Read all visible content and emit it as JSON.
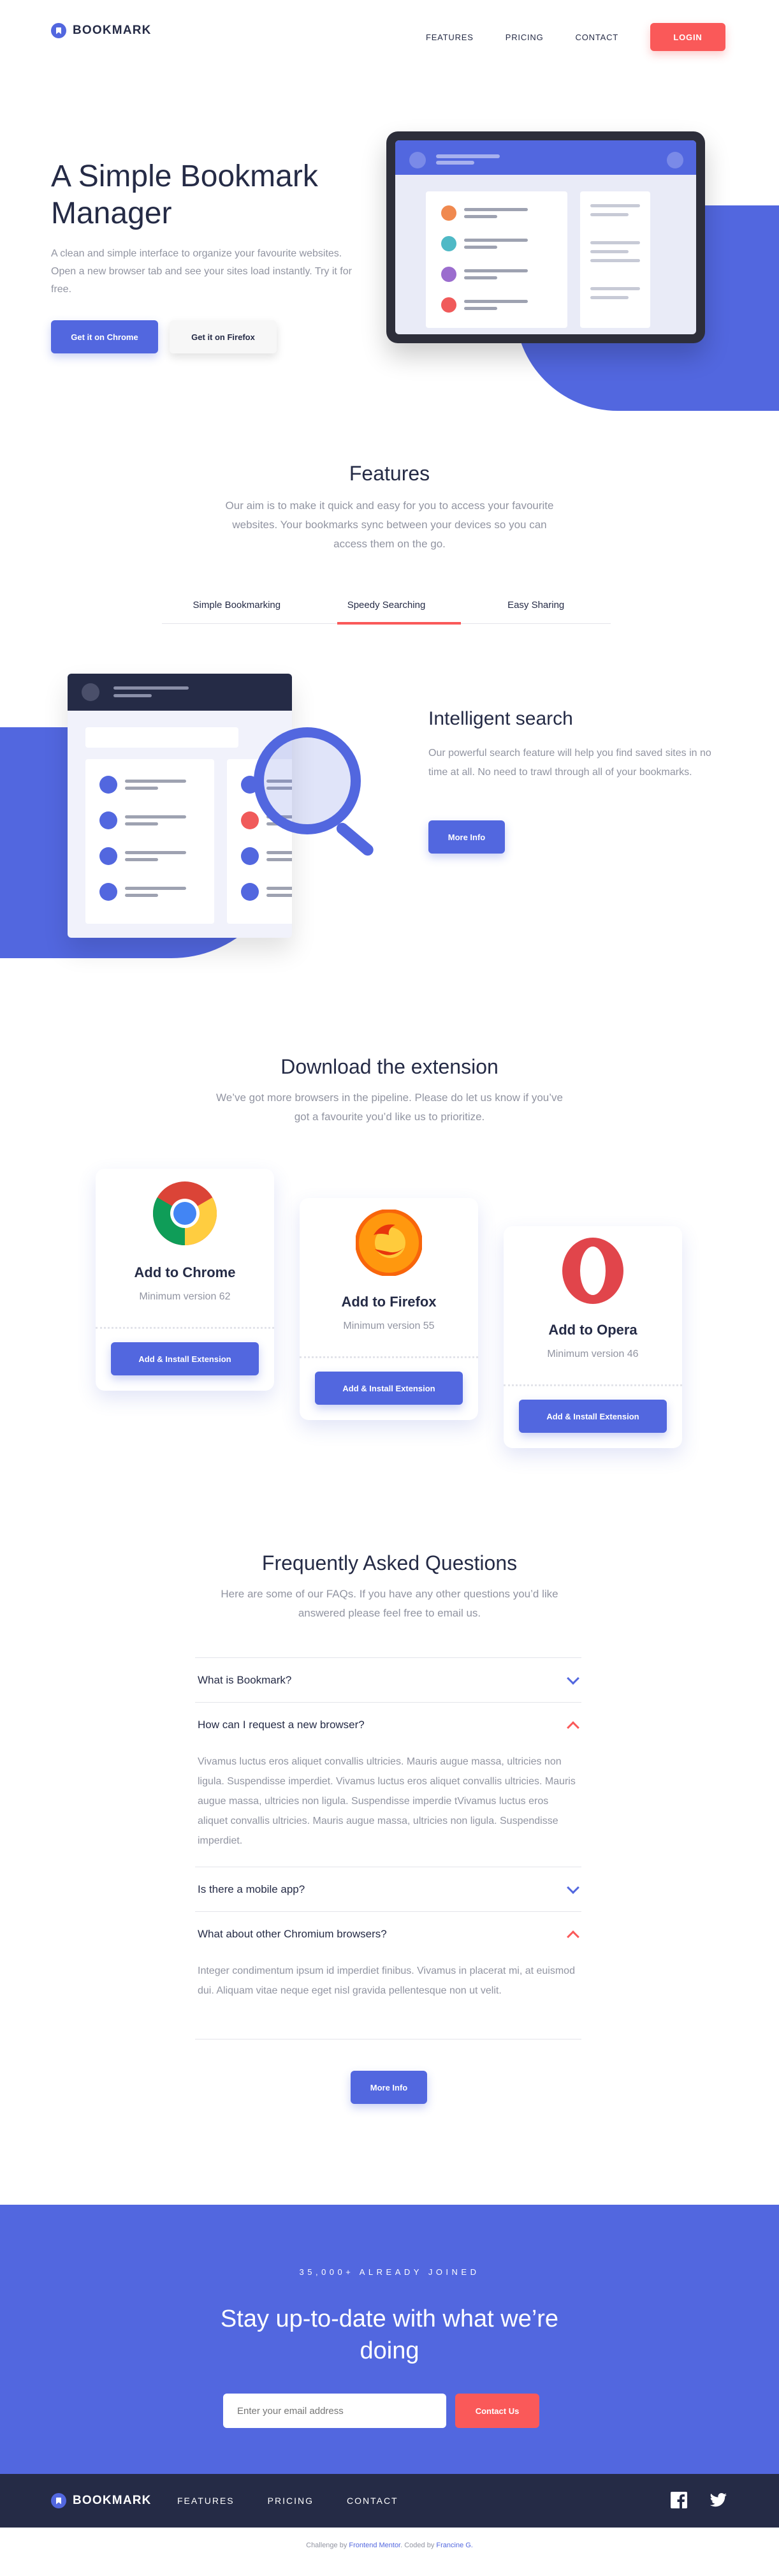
{
  "brand": {
    "name": "BOOKMARK"
  },
  "nav": {
    "features": "FEATURES",
    "pricing": "PRICING",
    "contact": "CONTACT",
    "login": "LOGIN"
  },
  "hero": {
    "title": "A Simple Bookmark Manager",
    "text": "A clean and simple interface to organize your favourite websites. Open a new browser tab and see your sites load instantly. Try it for free.",
    "chrome_button": "Get it on Chrome",
    "firefox_button": "Get it on Firefox"
  },
  "features": {
    "title": "Features",
    "text": "Our aim is to make it quick and easy for you to access your favourite websites. Your bookmarks sync between your devices so you can access them on the go.",
    "tabs": [
      "Simple Bookmarking",
      "Speedy Searching",
      "Easy Sharing"
    ],
    "active_tab": "Speedy Searching",
    "panel_title": "Intelligent search",
    "panel_text": "Our powerful search feature will help you find saved sites in no time at all. No need to trawl through all of your bookmarks.",
    "panel_button": "More Info"
  },
  "download": {
    "title": "Download the extension",
    "text": "We’ve got more browsers in the pipeline. Please do let us know if you’ve got a favourite you’d like us to prioritize.",
    "cards": [
      {
        "name": "Add to Chrome",
        "version": "Minimum version 62",
        "button": "Add & Install Extension",
        "icon": "chrome-logo"
      },
      {
        "name": "Add to Firefox",
        "version": "Minimum version 55",
        "button": "Add & Install Extension",
        "icon": "firefox-logo"
      },
      {
        "name": "Add to Opera",
        "version": "Minimum version 46",
        "button": "Add & Install Extension",
        "icon": "opera-logo"
      }
    ]
  },
  "faq": {
    "title": "Frequently Asked Questions",
    "text": "Here are some of our FAQs. If you have any other questions you’d like answered please feel free to email us.",
    "items": [
      {
        "q": "What is Bookmark?",
        "open": false,
        "a": ""
      },
      {
        "q": "How can I request a new browser?",
        "open": true,
        "a": "Vivamus luctus eros aliquet convallis ultricies. Mauris augue massa, ultricies non ligula. Suspendisse imperdiet. Vivamus luctus eros aliquet convallis ultricies. Mauris augue massa, ultricies non ligula. Suspendisse imperdie tVivamus luctus eros aliquet convallis ultricies. Mauris augue massa, ultricies non ligula. Suspendisse imperdiet."
      },
      {
        "q": "Is there a mobile app?",
        "open": false,
        "a": ""
      },
      {
        "q": "What about other Chromium browsers?",
        "open": true,
        "a": "Integer condimentum ipsum id imperdiet finibus. Vivamus in placerat mi, at euismod dui. Aliquam vitae neque eget nisl gravida pellentesque non ut velit."
      }
    ],
    "button": "More Info"
  },
  "cta": {
    "joined": "35,000+ ALREADY JOINED",
    "title": "Stay up-to-date with what we’re doing",
    "email_placeholder": "Enter your email address",
    "button": "Contact Us"
  },
  "footer": {
    "links": [
      "FEATURES",
      "PRICING",
      "CONTACT"
    ],
    "social": [
      "facebook-icon",
      "twitter-icon"
    ]
  },
  "attribution": {
    "prefix": "Challenge by",
    "org": "Frontend Mentor",
    "mid": ". Coded by",
    "author": "Francine G."
  },
  "colors": {
    "primary": "#5267DF",
    "accent": "#FA5959",
    "dark": "#252B46",
    "muted": "#9194A1"
  }
}
